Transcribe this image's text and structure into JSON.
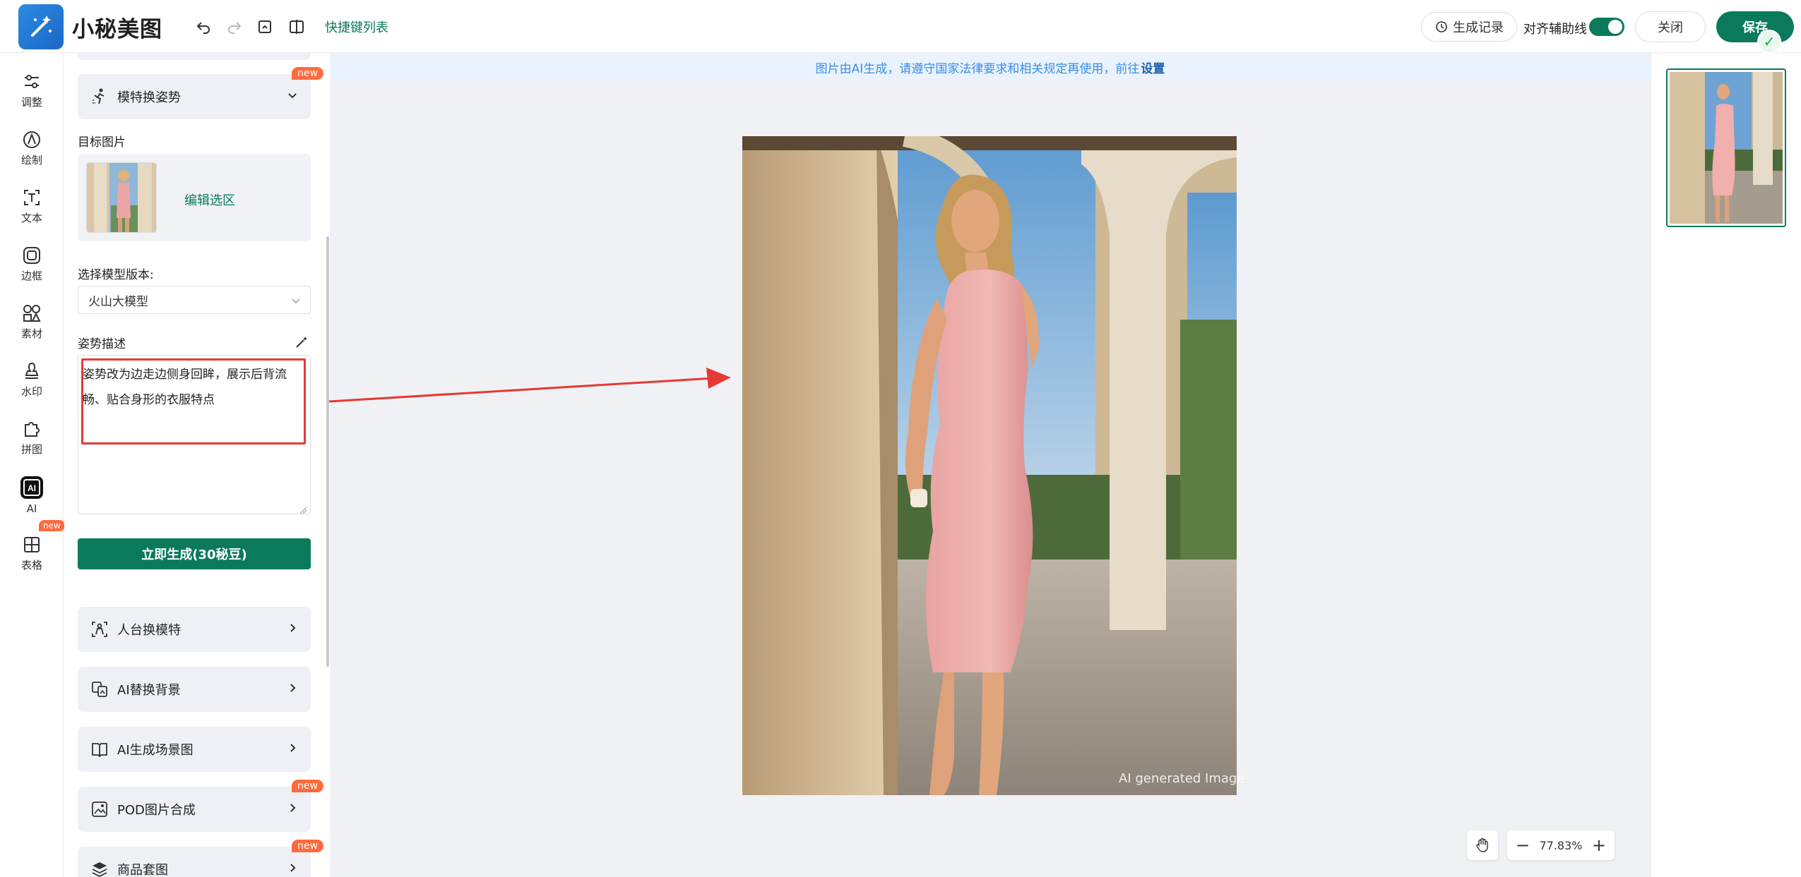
{
  "app": {
    "title": "小秘美图",
    "shortcut_link": "快捷键列表"
  },
  "toolbar": {
    "history_label": "生成记录",
    "align_label": "对齐辅助线",
    "align_enabled": true,
    "close_label": "关闭",
    "save_label": "保存"
  },
  "rail": {
    "items": [
      {
        "label": "调整",
        "icon": "sliders-icon"
      },
      {
        "label": "绘制",
        "icon": "pen-circle-icon"
      },
      {
        "label": "文本",
        "icon": "text-icon"
      },
      {
        "label": "边框",
        "icon": "frame-icon"
      },
      {
        "label": "素材",
        "icon": "shapes-icon"
      },
      {
        "label": "水印",
        "icon": "stamp-icon"
      },
      {
        "label": "拼图",
        "icon": "puzzle-icon"
      },
      {
        "label": "AI",
        "icon": "ai-icon",
        "active": true
      },
      {
        "label": "表格",
        "icon": "table-icon"
      }
    ],
    "ai_badge": "new"
  },
  "panel": {
    "pose_card": {
      "title": "模特换姿势",
      "badge": "new"
    },
    "target_label": "目标图片",
    "edit_link": "编辑选区",
    "model_label": "选择模型版本:",
    "model_value": "火山大模型",
    "pose_label": "姿势描述",
    "pose_text": "姿势改为边走边侧身回眸，展示后背流畅、贴合身形的衣服特点",
    "generate_label": "立即生成(30秘豆)",
    "cards": [
      {
        "title": "人台换模特",
        "icon": "mannequin-icon",
        "badge": ""
      },
      {
        "title": "AI替换背景",
        "icon": "bg-replace-icon",
        "badge": ""
      },
      {
        "title": "AI生成场景图",
        "icon": "scene-icon",
        "badge": ""
      },
      {
        "title": "POD图片合成",
        "icon": "pod-icon",
        "badge": "new"
      },
      {
        "title": "商品套图",
        "icon": "layers-icon",
        "badge": "new"
      }
    ]
  },
  "canvas": {
    "notice_text": "图片由AI生成，请遵守国家法律要求和相关规定再使用，前往",
    "notice_link": "设置",
    "watermark": "AI generated Image",
    "zoom": "77.83%"
  },
  "colors": {
    "accent": "#0b7a5c",
    "badge": "#ff6a3d",
    "notice_bg": "#eaf3fd",
    "highlight": "#e53935"
  }
}
